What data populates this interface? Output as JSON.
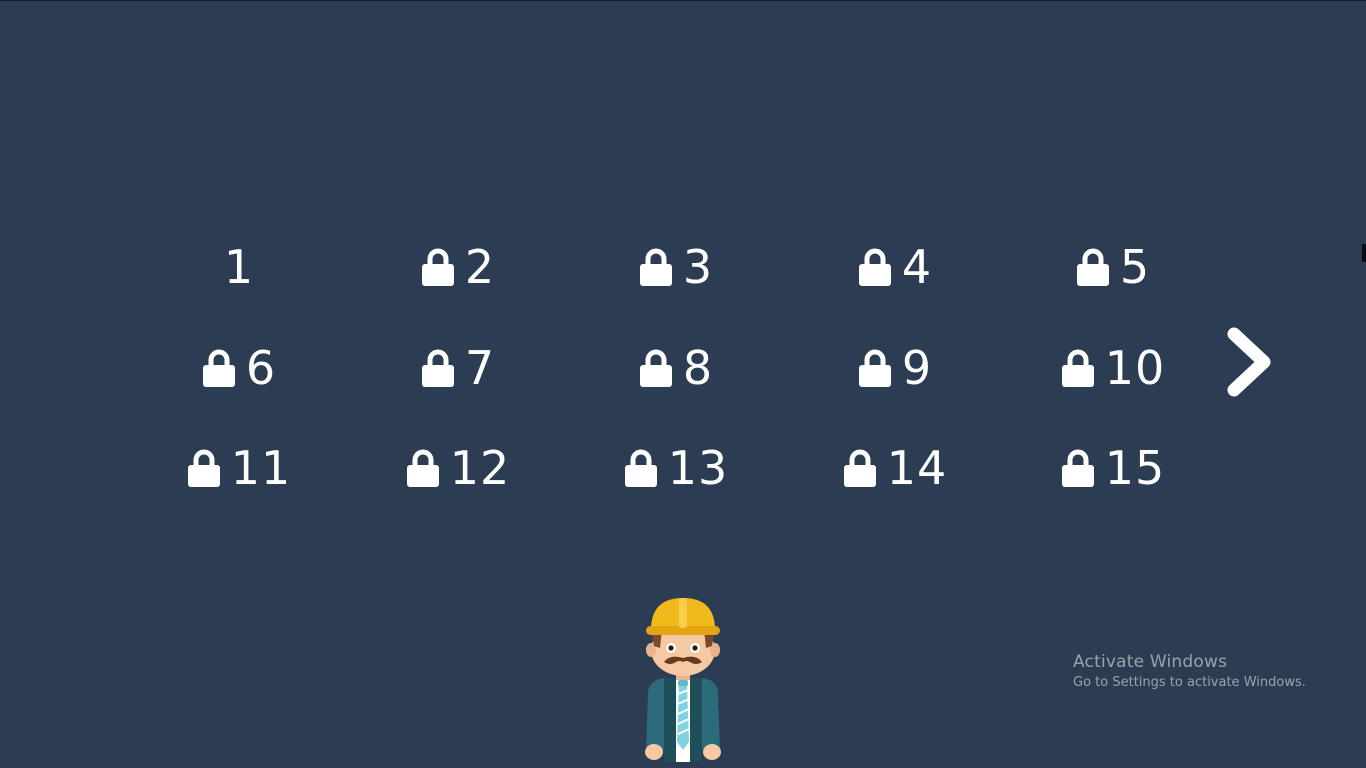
{
  "level_select": {
    "levels": [
      {
        "number": "1",
        "locked": false
      },
      {
        "number": "2",
        "locked": true
      },
      {
        "number": "3",
        "locked": true
      },
      {
        "number": "4",
        "locked": true
      },
      {
        "number": "5",
        "locked": true
      },
      {
        "number": "6",
        "locked": true
      },
      {
        "number": "7",
        "locked": true
      },
      {
        "number": "8",
        "locked": true
      },
      {
        "number": "9",
        "locked": true
      },
      {
        "number": "10",
        "locked": true
      },
      {
        "number": "11",
        "locked": true
      },
      {
        "number": "12",
        "locked": true
      },
      {
        "number": "13",
        "locked": true
      },
      {
        "number": "14",
        "locked": true
      },
      {
        "number": "15",
        "locked": true
      }
    ],
    "next_icon": "chevron-right-icon",
    "lock_icon": "lock-icon"
  },
  "character": {
    "icon": "construction-worker-mascot"
  },
  "watermark": {
    "title": "Activate Windows",
    "subtitle": "Go to Settings to activate Windows."
  },
  "colors": {
    "background": "#2c3c52",
    "foreground": "#ffffff",
    "helmet": "#f2b91c",
    "jacket": "#2b6b7a",
    "watermark": "#9aa3ad"
  }
}
